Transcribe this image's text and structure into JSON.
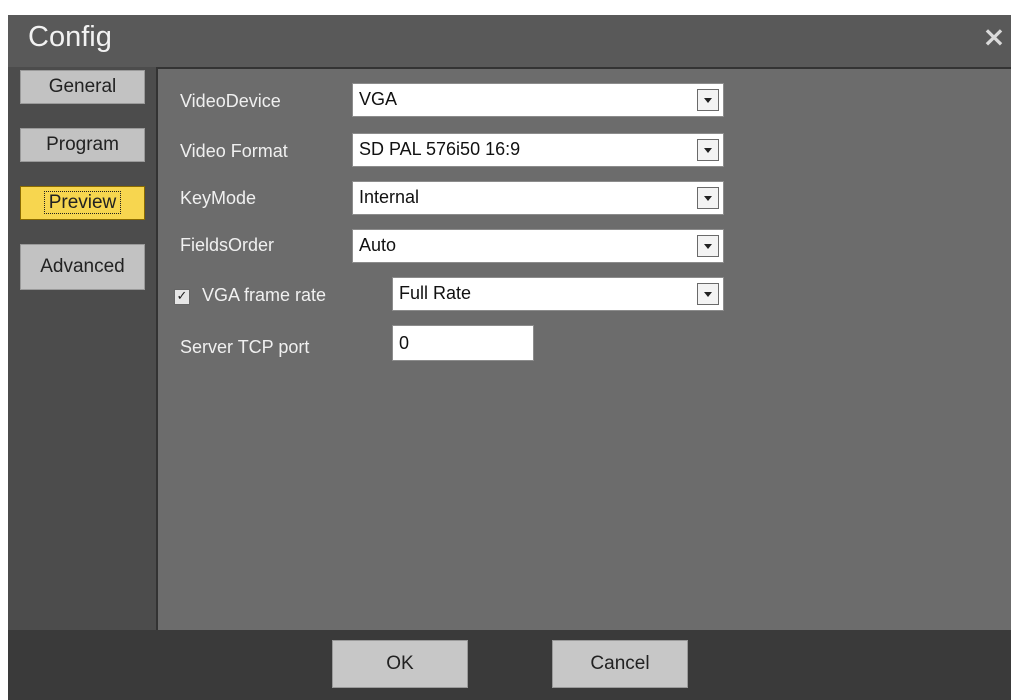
{
  "window": {
    "title": "Config",
    "close_icon": "×"
  },
  "sidebar": {
    "tabs": [
      {
        "label": "General"
      },
      {
        "label": "Program"
      },
      {
        "label": "Preview",
        "active": true
      },
      {
        "label": "Advanced"
      }
    ]
  },
  "form": {
    "video_device": {
      "label": "VideoDevice",
      "value": "VGA"
    },
    "video_format": {
      "label": "Video Format",
      "value": "SD PAL 576i50 16:9"
    },
    "key_mode": {
      "label": "KeyMode",
      "value": "Internal"
    },
    "fields_order": {
      "label": "FieldsOrder",
      "value": "Auto"
    },
    "vga_frame_rate": {
      "label": "VGA frame rate",
      "checked": true,
      "checkmark": "✓",
      "value": "Full Rate"
    },
    "server_tcp_port": {
      "label": "Server TCP port",
      "value": "0"
    }
  },
  "footer": {
    "ok_label": "OK",
    "cancel_label": "Cancel"
  },
  "colors": {
    "title_bar": "#595959",
    "panel": "#6c6c6c",
    "active_tab": "#f7d64f",
    "button": "#c7c7c7"
  }
}
